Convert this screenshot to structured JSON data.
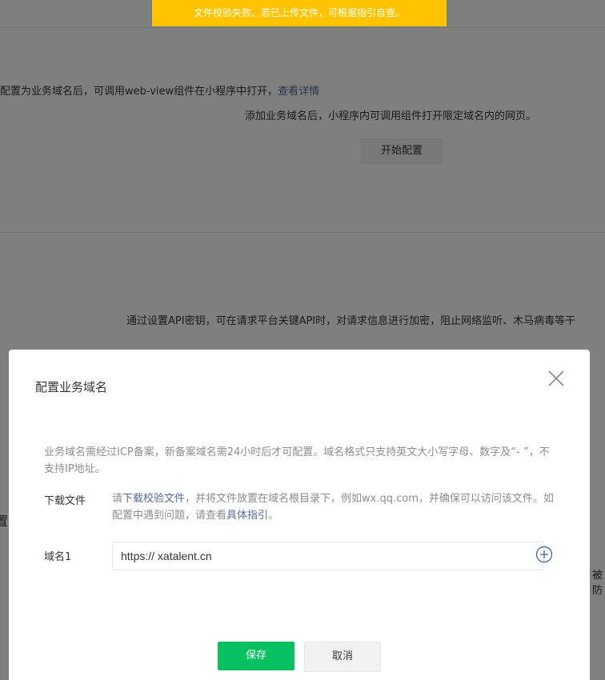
{
  "toast": {
    "message": "文件校验失败。若已上传文件，可根据指引自查。"
  },
  "background": {
    "section1": {
      "description": "配置为业务域名后，可调用web-view组件在小程序中打开，",
      "detail_link": "查看详情",
      "empty_tip": "添加业务域名后，小程序内可调用组件打开限定域名内的网页。",
      "start_button": "开始配置"
    },
    "section2": {
      "description": "通过设置API密钥，可在请求平台关键API时，对请求信息进行加密，阻止网络监听、木马病毒等干",
      "left_fragment": "置",
      "right_fragment": "被防"
    }
  },
  "dialog": {
    "title": "配置业务域名",
    "description": "业务域名需经过ICP备案，新备案域名需24小时后才可配置。域名格式只支持英文大小写字母、数字及“- ”，不支持IP地址。",
    "download": {
      "label": "下载文件",
      "text_prefix": "请",
      "download_link": "下载校验文件",
      "text_middle": "，并将文件放置在域名根目录下，例如wx.qq.com，并确保可以访问该文件。如配置中遇到问题，请查看",
      "guide_link": "具体指引",
      "text_suffix": "。"
    },
    "domain": {
      "label": "域名1",
      "value": "https:// xatalent.cn"
    },
    "buttons": {
      "save": "保存",
      "cancel": "取消"
    }
  },
  "colors": {
    "toast": "#ffc300",
    "primary": "#07c160",
    "link": "#576b95"
  },
  "icons": {
    "close": "close-icon",
    "add": "plus-circle-icon"
  }
}
